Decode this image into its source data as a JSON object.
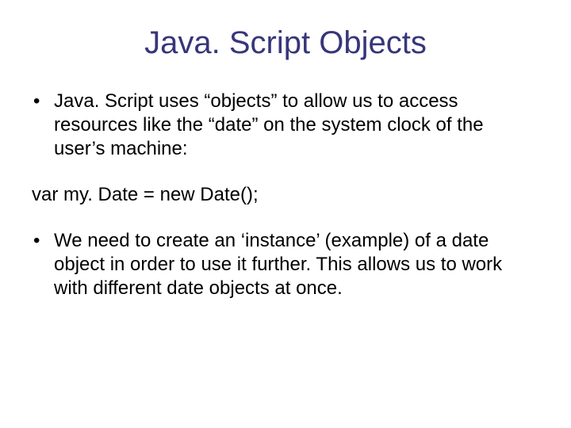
{
  "slide": {
    "title": "Java. Script Objects",
    "bullets": [
      {
        "dot": "•",
        "text": "Java. Script uses “objects” to allow us to access resources like the “date” on the system clock of the user’s machine:"
      },
      {
        "dot": "•",
        "text": "We need to create an ‘instance’ (example) of a date object in order to use it further.  This allows us to work with different date objects at once."
      }
    ],
    "code": "var my. Date = new Date();"
  }
}
